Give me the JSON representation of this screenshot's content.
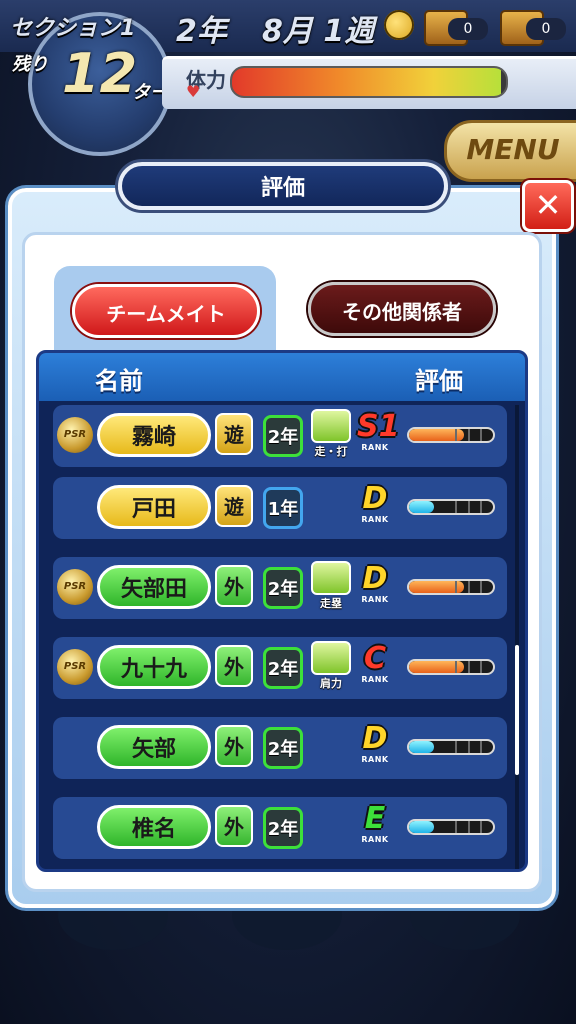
{
  "hud": {
    "section": "セクション1",
    "year": "2年",
    "week": "8月 1週",
    "remaining_label": "残り",
    "turns": "12",
    "turn_unit": "ターン",
    "stamina_label": "体力",
    "stamina_level": 0.98,
    "chest1_count": "0",
    "chest2_count": "0",
    "menu_label": "MENU"
  },
  "dialog": {
    "title": "評価",
    "close_label": "✕",
    "tabs": {
      "teammates": "チームメイト",
      "others": "その他関係者"
    },
    "columns": {
      "name": "名前",
      "rating": "評価"
    },
    "scroll_position": 0.72
  },
  "players": [
    {
      "name": "霧崎",
      "psr": true,
      "psr_label": "PSR",
      "position": "遊",
      "grade": "2年",
      "skill": "走・打",
      "rank": "S1",
      "rank_sub": "RANK",
      "rating_level": 0.65,
      "color": "yellow"
    },
    {
      "name": "戸田",
      "psr": false,
      "position": "遊",
      "grade": "1年",
      "skill": "",
      "rank": "D",
      "rank_sub": "RANK",
      "rating_level": 0.3,
      "color": "yellow"
    },
    {
      "name": "矢部田",
      "psr": true,
      "psr_label": "PSR",
      "position": "外",
      "grade": "2年",
      "skill": "走塁",
      "rank": "D",
      "rank_sub": "RANK",
      "rating_level": 0.65,
      "color": "green"
    },
    {
      "name": "九十九",
      "psr": true,
      "psr_label": "PSR",
      "position": "外",
      "grade": "2年",
      "skill": "肩力",
      "rank": "C",
      "rank_sub": "RANK",
      "rating_level": 0.65,
      "color": "green"
    },
    {
      "name": "矢部",
      "psr": false,
      "position": "外",
      "grade": "2年",
      "skill": "",
      "rank": "D",
      "rank_sub": "RANK",
      "rating_level": 0.3,
      "color": "green"
    },
    {
      "name": "椎名",
      "psr": false,
      "position": "外",
      "grade": "2年",
      "skill": "",
      "rank": "E",
      "rank_sub": "RANK",
      "rating_level": 0.3,
      "color": "green"
    }
  ],
  "colors": {
    "rank_S1": "#ff3a2a",
    "rank_D": "#ffd52a",
    "rank_C": "#ff3a2a",
    "rank_E": "#3de03a"
  }
}
